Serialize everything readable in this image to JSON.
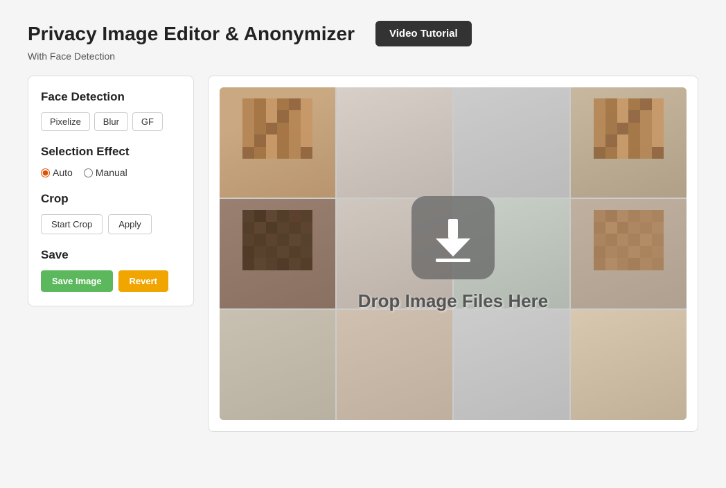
{
  "header": {
    "title": "Privacy Image Editor &  Anonymizer",
    "subtitle": "With Face Detection",
    "video_tutorial_label": "Video Tutorial"
  },
  "sidebar": {
    "face_detection_title": "Face Detection",
    "effect_buttons": [
      {
        "label": "Pixelize",
        "id": "pixelize"
      },
      {
        "label": "Blur",
        "id": "blur"
      },
      {
        "label": "GF",
        "id": "gf"
      }
    ],
    "selection_effect_title": "Selection Effect",
    "radio_options": [
      {
        "label": "Auto",
        "value": "auto",
        "checked": true
      },
      {
        "label": "Manual",
        "value": "manual",
        "checked": false
      }
    ],
    "crop_title": "Crop",
    "start_crop_label": "Start Crop",
    "apply_label": "Apply",
    "save_title": "Save",
    "save_image_label": "Save Image",
    "revert_label": "Revert"
  },
  "canvas": {
    "drop_text": "Drop Image Files Here"
  }
}
